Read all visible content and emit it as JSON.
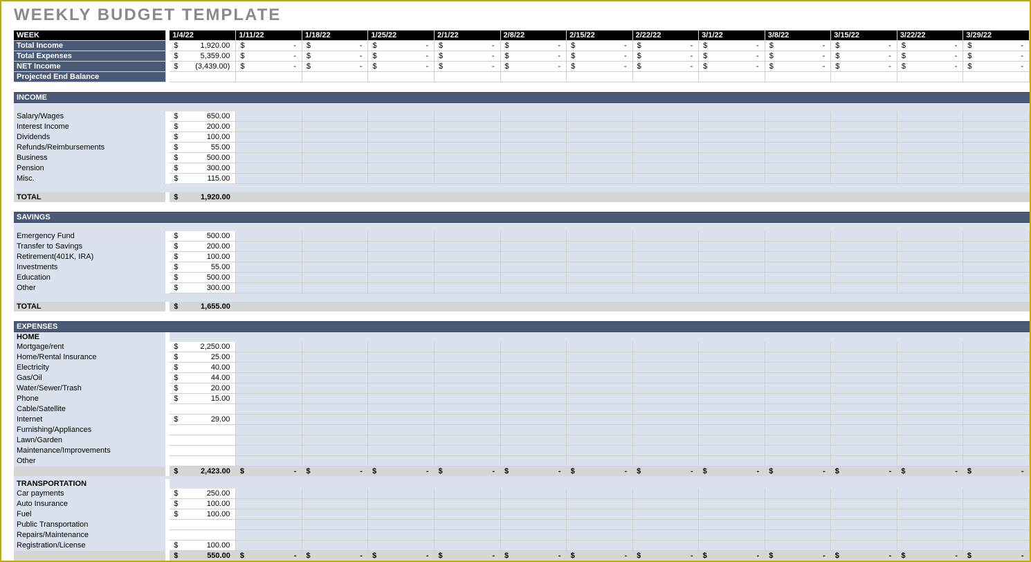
{
  "title": "WEEKLY BUDGET TEMPLATE",
  "dates": [
    "1/4/22",
    "1/11/22",
    "1/18/22",
    "1/25/22",
    "2/1/22",
    "2/8/22",
    "2/15/22",
    "2/22/22",
    "3/1/22",
    "3/8/22",
    "3/15/22",
    "3/22/22",
    "3/29/22"
  ],
  "summary": {
    "week_label": "WEEK",
    "rows": [
      {
        "label": "Total Income",
        "values": [
          "1,920.00",
          "-",
          "-",
          "-",
          "-",
          "-",
          "-",
          "-",
          "-",
          "-",
          "-",
          "-",
          "-"
        ]
      },
      {
        "label": "Total Expenses",
        "values": [
          "5,359.00",
          "-",
          "-",
          "-",
          "-",
          "-",
          "-",
          "-",
          "-",
          "-",
          "-",
          "-",
          "-"
        ]
      },
      {
        "label": "NET Income",
        "values": [
          "(3,439.00)",
          "-",
          "-",
          "-",
          "-",
          "-",
          "-",
          "-",
          "-",
          "-",
          "-",
          "-",
          "-"
        ]
      },
      {
        "label": "Projected End Balance",
        "values": [
          "",
          "",
          "",
          "",
          "",
          "",
          "",
          "",
          "",
          "",
          "",
          "",
          ""
        ]
      }
    ]
  },
  "sections": [
    {
      "header": "INCOME",
      "rows": [
        {
          "label": "Salary/Wages",
          "values": [
            "650.00",
            "",
            "",
            "",
            "",
            "",
            "",
            "",
            "",
            "",
            "",
            "",
            ""
          ]
        },
        {
          "label": "Interest Income",
          "values": [
            "200.00",
            "",
            "",
            "",
            "",
            "",
            "",
            "",
            "",
            "",
            "",
            "",
            ""
          ]
        },
        {
          "label": "Dividends",
          "values": [
            "100.00",
            "",
            "",
            "",
            "",
            "",
            "",
            "",
            "",
            "",
            "",
            "",
            ""
          ]
        },
        {
          "label": "Refunds/Reimbursements",
          "values": [
            "55.00",
            "",
            "",
            "",
            "",
            "",
            "",
            "",
            "",
            "",
            "",
            "",
            ""
          ]
        },
        {
          "label": "Business",
          "values": [
            "500.00",
            "",
            "",
            "",
            "",
            "",
            "",
            "",
            "",
            "",
            "",
            "",
            ""
          ]
        },
        {
          "label": "Pension",
          "values": [
            "300.00",
            "",
            "",
            "",
            "",
            "",
            "",
            "",
            "",
            "",
            "",
            "",
            ""
          ]
        },
        {
          "label": "Misc.",
          "values": [
            "115.00",
            "",
            "",
            "",
            "",
            "",
            "",
            "",
            "",
            "",
            "",
            "",
            ""
          ]
        }
      ],
      "total": {
        "label": "TOTAL",
        "values": [
          "1,920.00",
          "",
          "",
          "",
          "",
          "",
          "",
          "",
          "",
          "",
          "",
          "",
          ""
        ]
      }
    },
    {
      "header": "SAVINGS",
      "rows": [
        {
          "label": "Emergency Fund",
          "values": [
            "500.00",
            "",
            "",
            "",
            "",
            "",
            "",
            "",
            "",
            "",
            "",
            "",
            ""
          ]
        },
        {
          "label": "Transfer to Savings",
          "values": [
            "200.00",
            "",
            "",
            "",
            "",
            "",
            "",
            "",
            "",
            "",
            "",
            "",
            ""
          ]
        },
        {
          "label": "Retirement(401K, IRA)",
          "values": [
            "100.00",
            "",
            "",
            "",
            "",
            "",
            "",
            "",
            "",
            "",
            "",
            "",
            ""
          ]
        },
        {
          "label": "Investments",
          "values": [
            "55.00",
            "",
            "",
            "",
            "",
            "",
            "",
            "",
            "",
            "",
            "",
            "",
            ""
          ]
        },
        {
          "label": "Education",
          "values": [
            "500.00",
            "",
            "",
            "",
            "",
            "",
            "",
            "",
            "",
            "",
            "",
            "",
            ""
          ]
        },
        {
          "label": "Other",
          "values": [
            "300.00",
            "",
            "",
            "",
            "",
            "",
            "",
            "",
            "",
            "",
            "",
            "",
            ""
          ]
        }
      ],
      "total": {
        "label": "TOTAL",
        "values": [
          "1,655.00",
          "",
          "",
          "",
          "",
          "",
          "",
          "",
          "",
          "",
          "",
          "",
          ""
        ]
      }
    },
    {
      "header": "EXPENSES",
      "groups": [
        {
          "sub": "HOME",
          "rows": [
            {
              "label": "Mortgage/rent",
              "values": [
                "2,250.00",
                "",
                "",
                "",
                "",
                "",
                "",
                "",
                "",
                "",
                "",
                "",
                ""
              ]
            },
            {
              "label": "Home/Rental Insurance",
              "values": [
                "25.00",
                "",
                "",
                "",
                "",
                "",
                "",
                "",
                "",
                "",
                "",
                "",
                ""
              ]
            },
            {
              "label": "Electricity",
              "values": [
                "40.00",
                "",
                "",
                "",
                "",
                "",
                "",
                "",
                "",
                "",
                "",
                "",
                ""
              ]
            },
            {
              "label": "Gas/Oil",
              "values": [
                "44.00",
                "",
                "",
                "",
                "",
                "",
                "",
                "",
                "",
                "",
                "",
                "",
                ""
              ]
            },
            {
              "label": "Water/Sewer/Trash",
              "values": [
                "20.00",
                "",
                "",
                "",
                "",
                "",
                "",
                "",
                "",
                "",
                "",
                "",
                ""
              ]
            },
            {
              "label": "Phone",
              "values": [
                "15.00",
                "",
                "",
                "",
                "",
                "",
                "",
                "",
                "",
                "",
                "",
                "",
                ""
              ]
            },
            {
              "label": "Cable/Satellite",
              "values": [
                "",
                "",
                "",
                "",
                "",
                "",
                "",
                "",
                "",
                "",
                "",
                "",
                ""
              ]
            },
            {
              "label": "Internet",
              "values": [
                "29.00",
                "",
                "",
                "",
                "",
                "",
                "",
                "",
                "",
                "",
                "",
                "",
                ""
              ]
            },
            {
              "label": "Furnishing/Appliances",
              "values": [
                "",
                "",
                "",
                "",
                "",
                "",
                "",
                "",
                "",
                "",
                "",
                "",
                ""
              ]
            },
            {
              "label": "Lawn/Garden",
              "values": [
                "",
                "",
                "",
                "",
                "",
                "",
                "",
                "",
                "",
                "",
                "",
                "",
                ""
              ]
            },
            {
              "label": "Maintenance/Improvements",
              "values": [
                "",
                "",
                "",
                "",
                "",
                "",
                "",
                "",
                "",
                "",
                "",
                "",
                ""
              ]
            },
            {
              "label": "Other",
              "values": [
                "",
                "",
                "",
                "",
                "",
                "",
                "",
                "",
                "",
                "",
                "",
                "",
                ""
              ]
            }
          ],
          "subtotal": {
            "values": [
              "2,423.00",
              "-",
              "-",
              "-",
              "-",
              "-",
              "-",
              "-",
              "-",
              "-",
              "-",
              "-",
              "-"
            ]
          }
        },
        {
          "sub": "TRANSPORTATION",
          "rows": [
            {
              "label": "Car payments",
              "values": [
                "250.00",
                "",
                "",
                "",
                "",
                "",
                "",
                "",
                "",
                "",
                "",
                "",
                ""
              ]
            },
            {
              "label": "Auto Insurance",
              "values": [
                "100.00",
                "",
                "",
                "",
                "",
                "",
                "",
                "",
                "",
                "",
                "",
                "",
                ""
              ]
            },
            {
              "label": "Fuel",
              "values": [
                "100.00",
                "",
                "",
                "",
                "",
                "",
                "",
                "",
                "",
                "",
                "",
                "",
                ""
              ]
            },
            {
              "label": "Public Transportation",
              "values": [
                "",
                "",
                "",
                "",
                "",
                "",
                "",
                "",
                "",
                "",
                "",
                "",
                ""
              ]
            },
            {
              "label": "Repairs/Maintenance",
              "values": [
                "",
                "",
                "",
                "",
                "",
                "",
                "",
                "",
                "",
                "",
                "",
                "",
                ""
              ]
            },
            {
              "label": "Registration/License",
              "values": [
                "100.00",
                "",
                "",
                "",
                "",
                "",
                "",
                "",
                "",
                "",
                "",
                "",
                ""
              ]
            }
          ],
          "subtotal": {
            "values": [
              "550.00",
              "-",
              "-",
              "-",
              "-",
              "-",
              "-",
              "-",
              "-",
              "-",
              "-",
              "-",
              "-"
            ]
          }
        }
      ]
    }
  ]
}
